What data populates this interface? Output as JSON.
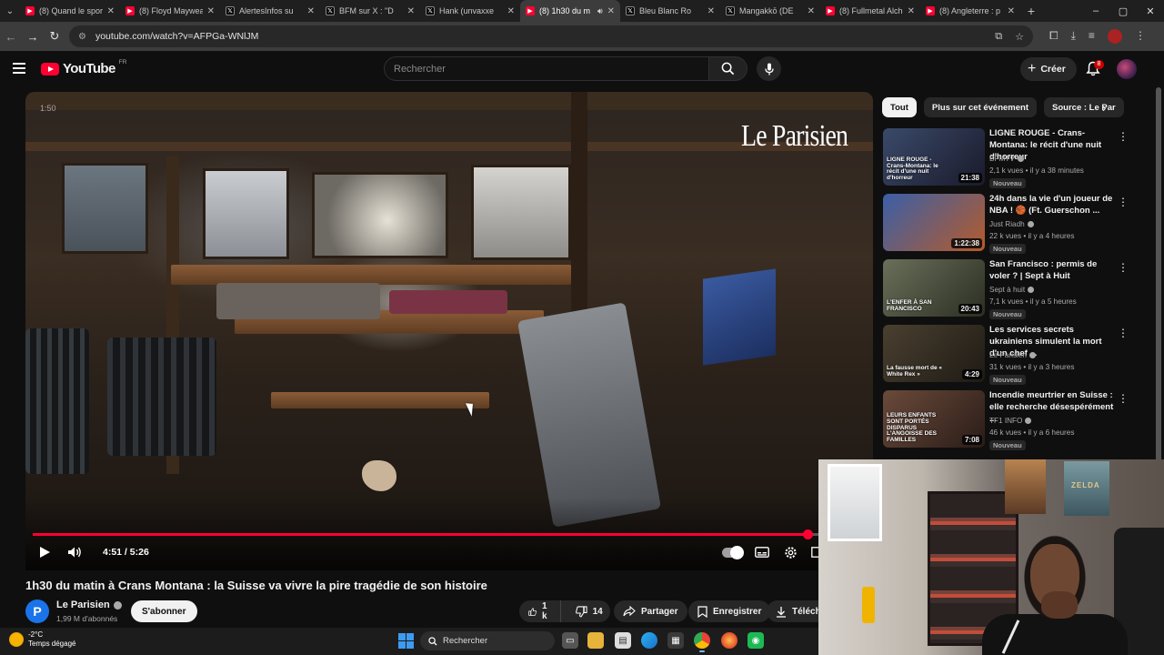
{
  "browser": {
    "tabs": [
      {
        "title": "(8) Quand le sport",
        "favicon": "youtube-icon"
      },
      {
        "title": "(8) Floyd Maywea",
        "favicon": "youtube-icon"
      },
      {
        "title": "AlertesInfos su",
        "favicon": "x-icon"
      },
      {
        "title": "BFM sur X : \"D",
        "favicon": "x-icon"
      },
      {
        "title": "Hank (unvaxxe",
        "favicon": "x-icon"
      },
      {
        "title": "(8) 1h30 du m",
        "favicon": "youtube-icon",
        "active": true,
        "audio": true
      },
      {
        "title": "Bleu Blanc Ro",
        "favicon": "x-icon"
      },
      {
        "title": "Mangakkō (DE",
        "favicon": "x-icon"
      },
      {
        "title": "(8) Fullmetal Alch",
        "favicon": "youtube-icon"
      },
      {
        "title": "(8) Angleterre : p",
        "favicon": "youtube-icon"
      }
    ],
    "url": "youtube.com/watch?v=AFPGa-WNlJM"
  },
  "masthead": {
    "logo_text": "YouTube",
    "region": "FR",
    "search_placeholder": "Rechercher",
    "create_label": "Créer",
    "notification_count": "8"
  },
  "player": {
    "watermark_time": "1:50",
    "brand_watermark": "Le Parisien",
    "time_display": "4:51 / 5:26",
    "progress_fraction": 0.93
  },
  "video": {
    "title": "1h30 du matin à Crans Montana : la Suisse va vivre la pire tragédie de son histoire",
    "channel": "Le Parisien",
    "channel_initial": "P",
    "subscribers": "1,99 M d'abonnés",
    "subscribe_label": "S'abonner",
    "likes": "1 k",
    "dislikes": "14",
    "share_label": "Partager",
    "save_label": "Enregistrer",
    "download_label": "Téléchar"
  },
  "sidebar": {
    "chips": [
      "Tout",
      "Plus sur cet événement",
      "Source : Le Par"
    ],
    "recommendations": [
      {
        "title": "LIGNE ROUGE - Crans-Montana: le récit d'une nuit d'horreur",
        "channel": "BFMTV",
        "meta": "2,1 k vues • il y a 38 minutes",
        "badge": "Nouveau",
        "duration": "21:38",
        "thumb_caption": "LIGNE ROUGE - Crans-Montana: le récit d'une nuit d'horreur",
        "thumb_colors": [
          "#3a4a6a",
          "#1a1a2a"
        ]
      },
      {
        "title": "24h dans la vie d'un joueur de NBA ! 🏀 (Ft. Guerschon ...",
        "channel": "Just Riadh",
        "meta": "22 k vues • il y a 4 heures",
        "badge": "Nouveau",
        "duration": "1:22:38",
        "thumb_caption": "",
        "thumb_colors": [
          "#3a5fa8",
          "#b55b2a"
        ]
      },
      {
        "title": "San Francisco : permis de voler ? | Sept à Huit",
        "channel": "Sept à huit",
        "meta": "7,1 k vues • il y a 5 heures",
        "badge": "Nouveau",
        "duration": "20:43",
        "thumb_caption": "L'ENFER À SAN FRANCISCO",
        "thumb_colors": [
          "#6a6f5a",
          "#2b2e22"
        ]
      },
      {
        "title": "Les services secrets ukrainiens simulent la mort d'un chef ...",
        "channel": "Le Parisien",
        "meta": "31 k vues • il y a 3 heures",
        "badge": "Nouveau",
        "duration": "4:29",
        "thumb_caption": "La fausse mort de « White Rex »",
        "thumb_colors": [
          "#4a4030",
          "#1e1a14"
        ]
      },
      {
        "title": "Incendie meurtrier en Suisse : elle recherche désespérément ...",
        "channel": "TF1 INFO",
        "meta": "46 k vues • il y a 6 heures",
        "badge": "Nouveau",
        "duration": "7:08",
        "thumb_caption": "LEURS ENFANTS SONT PORTÉS DISPARUS L'ANGOISSE DES FAMILLES",
        "thumb_colors": [
          "#6a4a3a",
          "#2a1c18"
        ]
      }
    ]
  },
  "webcam": {
    "poster_text": "ZELDA"
  },
  "taskbar": {
    "temperature": "-2°C",
    "weather": "Temps dégagé",
    "search_label": "Rechercher"
  },
  "colors": {
    "accent_red": "#ff0033",
    "background": "#0f0f0f",
    "chip_bg": "#272727"
  }
}
